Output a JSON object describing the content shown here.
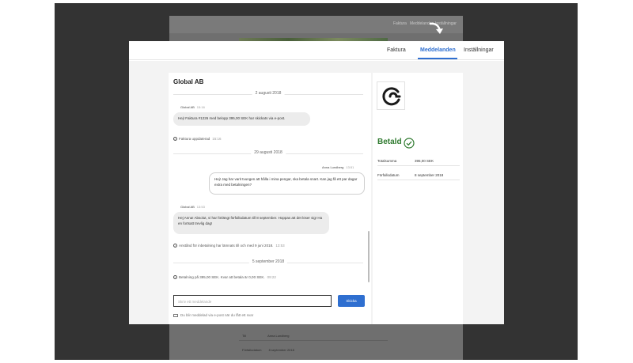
{
  "background_page": {
    "nav": [
      "Faktura",
      "Meddelanden",
      "Inställningar"
    ],
    "rows": [
      {
        "label": "Till",
        "value": "Anna Lundberg"
      },
      {
        "label": "Förfallodatum",
        "value": "8 september 2018"
      }
    ]
  },
  "tabs": [
    "Faktura",
    "Meddelanden",
    "Inställningar"
  ],
  "active_tab": "Meddelanden",
  "chat": {
    "company_name": "Global AB",
    "date_1": "2 augusti 2018",
    "msg_1_sender": "Global AB",
    "msg_1_time": "15:16",
    "msg_1_text": "Hej! Faktura #1226 med belopp 395,00 SEK har skickats via e-post.",
    "event_1_text": "Faktura uppdaterad",
    "event_1_time": "15:16",
    "date_2": "29 augusti 2018",
    "msg_2_sender": "Anna Lundberg",
    "msg_2_time": "13:51",
    "msg_2_text": "Hej! Jag har varit tvungen att hålla i mina pengar, ska betala snart. Kan jag få ett par dagar extra med betalningen?",
    "msg_3_sender": "Global AB",
    "msg_3_time": "13:53",
    "msg_3_text": "Hej Anna! Absolut, vi har förlängt förfallodatum till 8 september. Hoppas att det löser sig! Ha en fortsatt trevlig dag!",
    "event_2_text": "Anstånd för inbetalning har lämnats till och med 9 juni 2018.",
    "event_2_time": "13:53",
    "date_3": "5 september 2018",
    "event_3_text": "Betalning på 395,00 SEK. Kvar att betala är 0,00 SEK.",
    "event_3_time": "09:22",
    "input_placeholder": "Skriv ett meddelande",
    "send_label": "Skicka",
    "notify_text": "Du blir meddelad via e-post när du fått ett svar"
  },
  "sidebar": {
    "status": "Betald",
    "total_label": "Totalsumma",
    "total_value": "395,00 SEK",
    "due_label": "Förfallodatum",
    "due_value": "8 september 2018"
  },
  "colors": {
    "accent": "#2f6fd0",
    "paid": "#2f7a2f",
    "overlay": "#333333"
  }
}
